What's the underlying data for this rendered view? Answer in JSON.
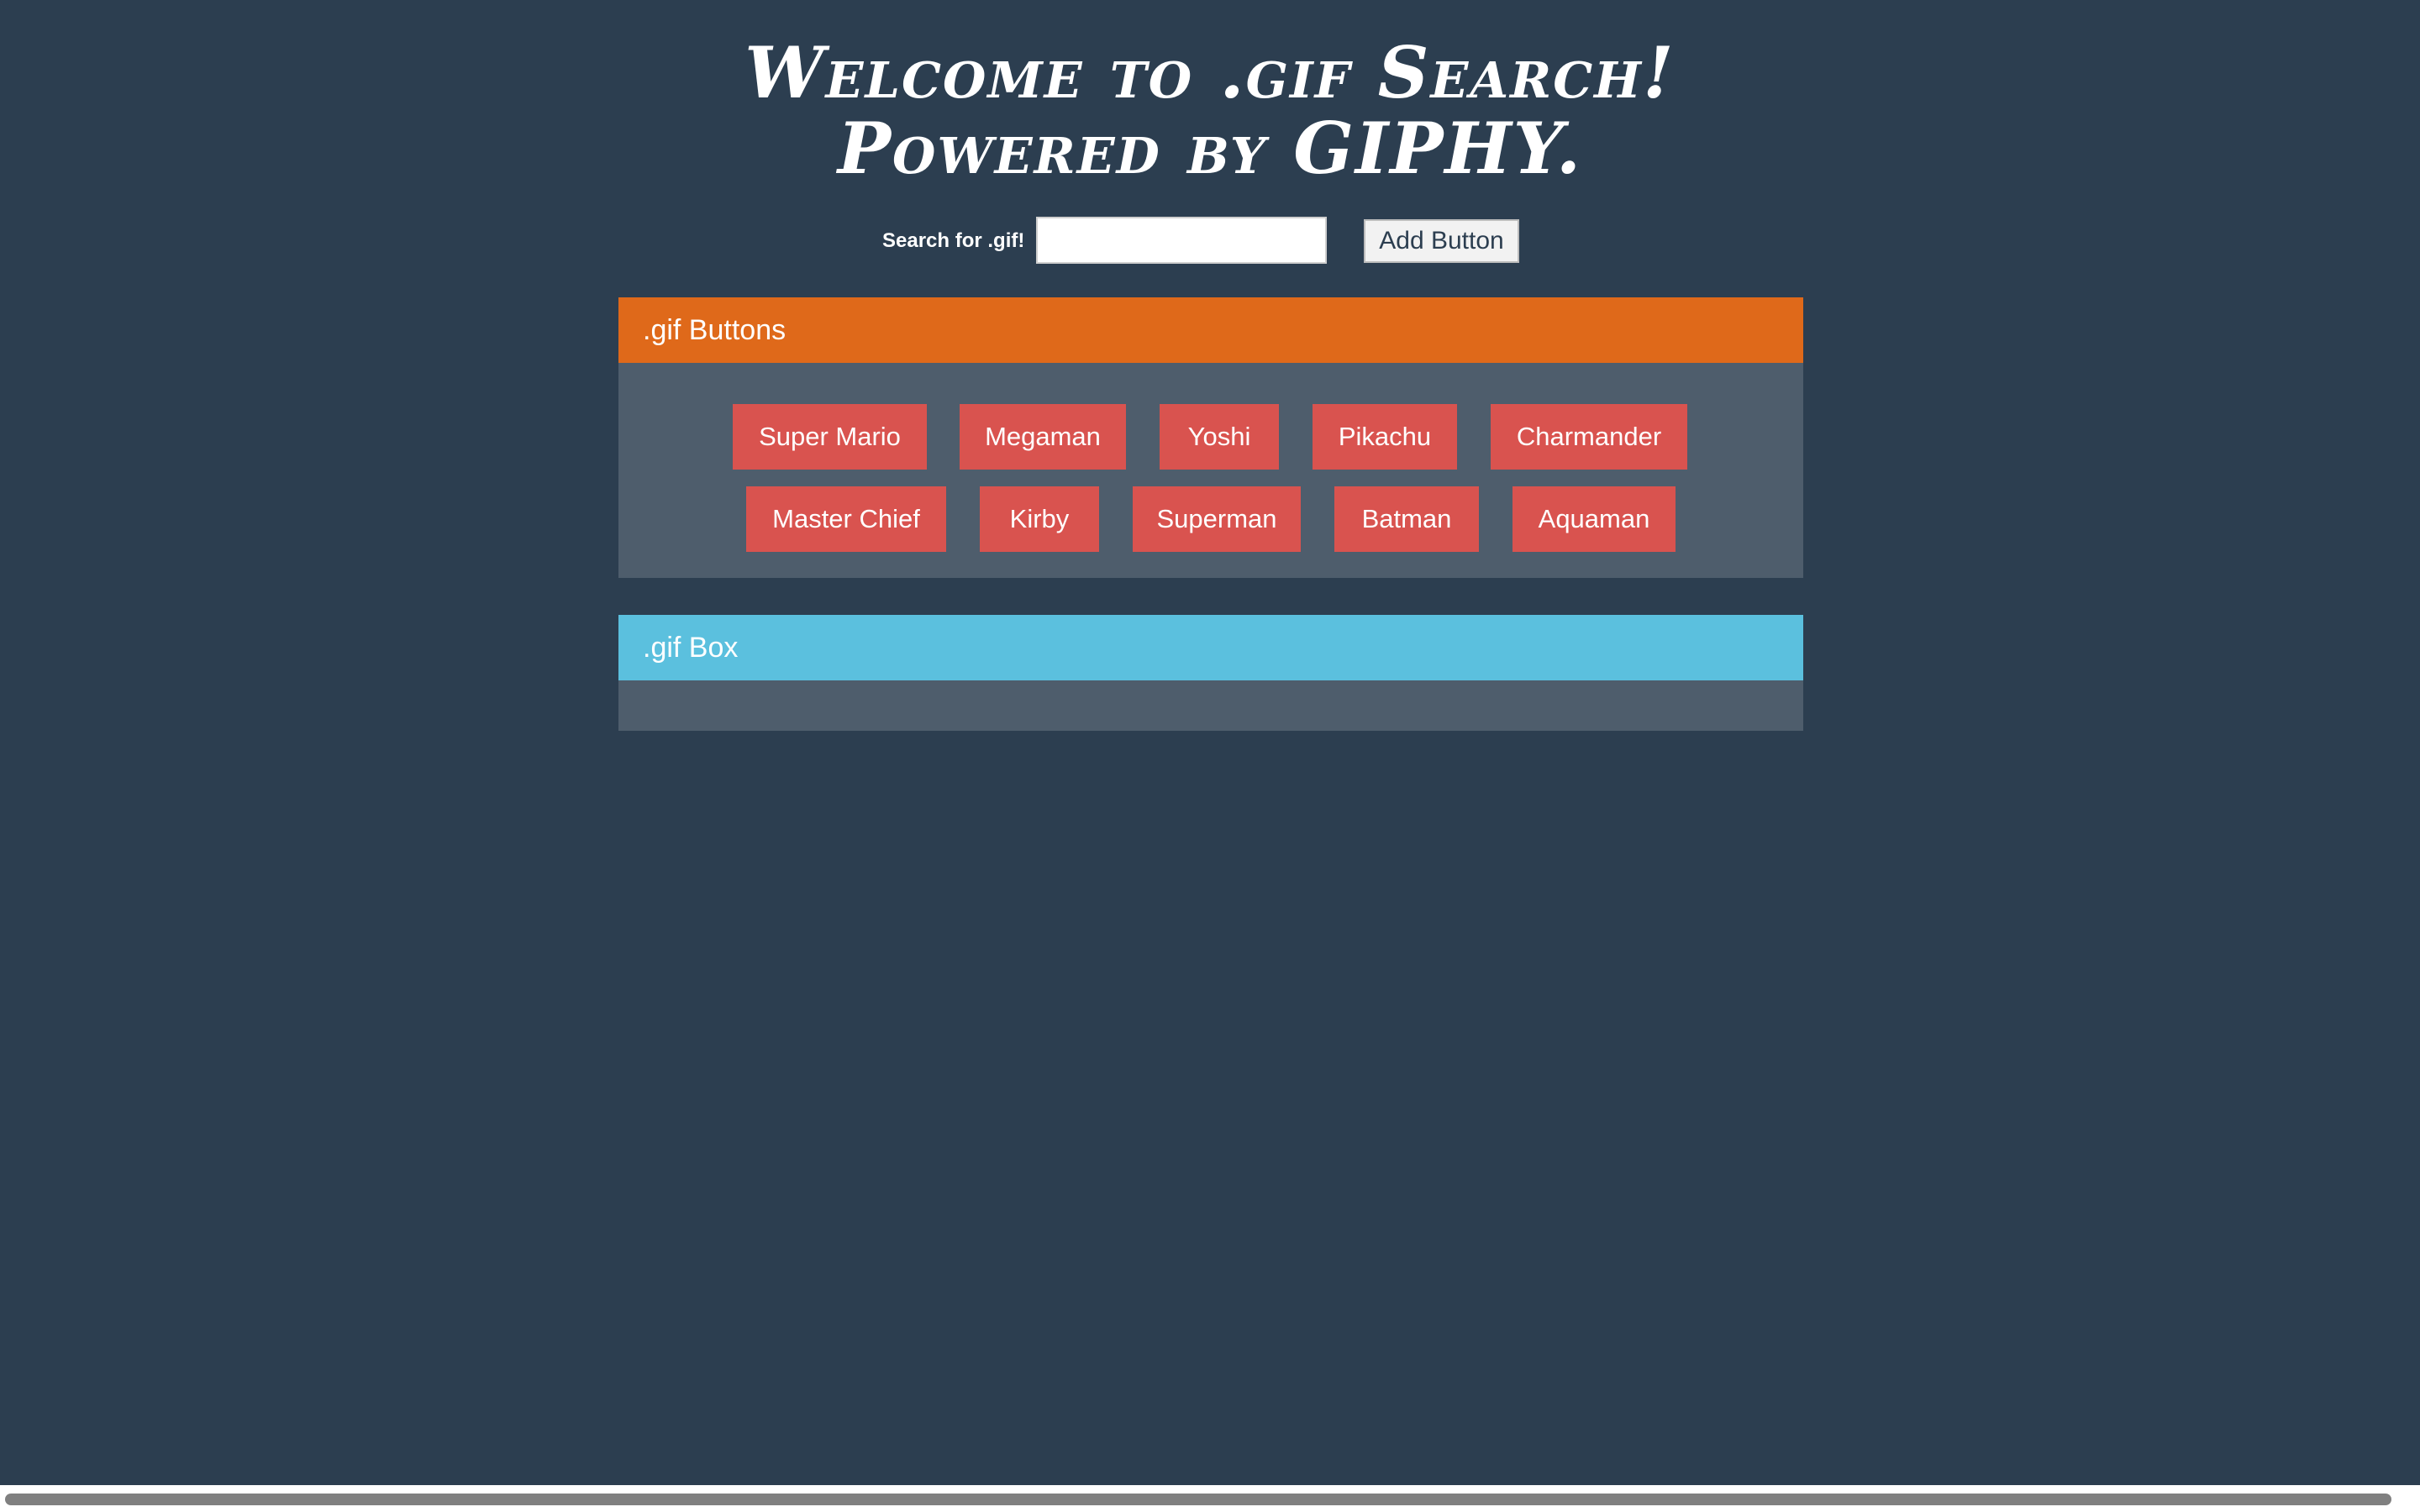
{
  "header": {
    "title_line1": "Welcome to .gif Search!",
    "title_line2": "Powered by GIPHY."
  },
  "search": {
    "label": "Search for .gif!",
    "value": "",
    "placeholder": "",
    "add_button_label": "Add Button"
  },
  "buttons_panel": {
    "heading": ".gif Buttons",
    "heading_color": "#df691a",
    "row1": [
      {
        "label": "Super Mario"
      },
      {
        "label": "Megaman"
      },
      {
        "label": "Yoshi"
      },
      {
        "label": "Pikachu"
      },
      {
        "label": "Charmander"
      }
    ],
    "row2": [
      {
        "label": "Master Chief"
      },
      {
        "label": "Kirby"
      },
      {
        "label": "Superman"
      },
      {
        "label": "Batman"
      },
      {
        "label": "Aquaman"
      }
    ]
  },
  "gif_box_panel": {
    "heading": ".gif Box",
    "heading_color": "#5bc0de"
  },
  "colors": {
    "background": "#2c3e50",
    "panel_body": "#4e5d6c",
    "gif_button": "#d9534f"
  }
}
